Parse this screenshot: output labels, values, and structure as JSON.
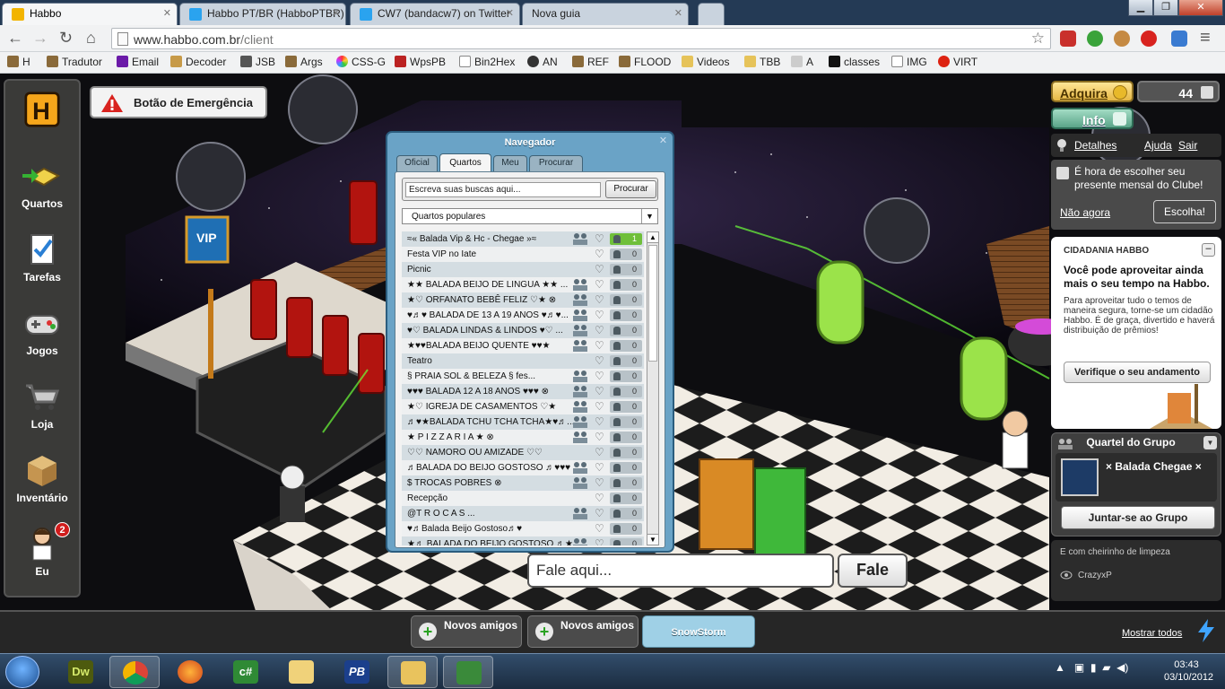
{
  "browser": {
    "tabs": [
      {
        "label": "Habbo",
        "active": true
      },
      {
        "label": "Habbo PT/BR (HabboPTBR)",
        "active": false
      },
      {
        "label": "CW7 (bandacw7) on Twitter",
        "active": false
      },
      {
        "label": "Nova guia",
        "active": false
      }
    ],
    "url_domain": "www.habbo.com.br",
    "url_path": "/client",
    "bookmarks": [
      "H",
      "Tradutor",
      "Email",
      "Decoder",
      "JSB",
      "Args",
      "CSS-G",
      "WpsPB",
      "Bin2Hex",
      "AN",
      "REF",
      "FLOOD",
      "Videos",
      "TBB",
      "A",
      "classes",
      "IMG",
      "VIRT"
    ]
  },
  "toolbar": {
    "items": [
      {
        "label": "Quartos",
        "icon": "rooms-icon"
      },
      {
        "label": "Tarefas",
        "icon": "quests-icon"
      },
      {
        "label": "Jogos",
        "icon": "gamepad-icon"
      },
      {
        "label": "Loja",
        "icon": "shop-cart-icon"
      },
      {
        "label": "Inventário",
        "icon": "inventory-box-icon"
      },
      {
        "label": "Eu",
        "icon": "avatar-icon",
        "badge": "2"
      }
    ]
  },
  "emergency": {
    "label": "Botão de Emergência"
  },
  "navigator": {
    "title": "Navegador",
    "tabs": [
      "Oficial",
      "Quartos",
      "Meu",
      "Procurar"
    ],
    "active_tab": "Quartos",
    "search_placeholder": "Escreva suas buscas aqui...",
    "search_button": "Procurar",
    "category": "Quartos populares",
    "rooms": [
      {
        "name": "≈« Balada Vip & Hc - Chegae »≈",
        "group": true,
        "count": "1",
        "active": true
      },
      {
        "name": "Festa VIP no Iate",
        "group": false,
        "count": "0",
        "active": false
      },
      {
        "name": "Picnic",
        "group": false,
        "count": "0",
        "active": false
      },
      {
        "name": "★★ BALADA BEIJO DE LINGUA ★★ ...",
        "group": true,
        "count": "0",
        "active": false
      },
      {
        "name": "★♡ ORFANATO BEBÊ FELIZ ♡★ ⊗",
        "group": true,
        "count": "0",
        "active": false
      },
      {
        "name": "♥♬♥ BALADA DE 13 A 19 ANOS ♥♬♥...",
        "group": true,
        "count": "0",
        "active": false
      },
      {
        "name": "♥♡ BALADA LINDAS & LINDOS ♥♡ ...",
        "group": true,
        "count": "0",
        "active": false
      },
      {
        "name": "★♥♥BALADA BEIJO QUENTE ♥♥★",
        "group": true,
        "count": "0",
        "active": false
      },
      {
        "name": "Teatro",
        "group": false,
        "count": "0",
        "active": false
      },
      {
        "name": "§ PRAIA SOL & BELEZA § fes...",
        "group": true,
        "count": "0",
        "active": false
      },
      {
        "name": "♥♥♥ BALADA  12 A 18 ANOS ♥♥♥ ⊗",
        "group": true,
        "count": "0",
        "active": false
      },
      {
        "name": "★♡ IGREJA DE CASAMENTOS ♡★",
        "group": true,
        "count": "0",
        "active": false
      },
      {
        "name": "♬♥★BALADA TCHU TCHA TCHA★♥♬...",
        "group": true,
        "count": "0",
        "active": false
      },
      {
        "name": "★   P I Z Z A R I A   ★  ⊗",
        "group": true,
        "count": "0",
        "active": false
      },
      {
        "name": "♡♡ NAMORO OU AMIZADE ♡♡",
        "group": false,
        "count": "0",
        "active": false
      },
      {
        "name": "♬BALADA DO BEIJO GOSTOSO ♬♥♥♥ ...",
        "group": true,
        "count": "0",
        "active": false
      },
      {
        "name": "$ TROCAS POBRES      ⊗",
        "group": true,
        "count": "0",
        "active": false
      },
      {
        "name": "Recepção",
        "group": false,
        "count": "0",
        "active": false
      },
      {
        "name": "@T   R   O   C   A   S ...",
        "group": true,
        "count": "0",
        "active": false
      },
      {
        "name": "♥♬Balada Beijo Gostoso♬♥",
        "group": false,
        "count": "0",
        "active": false
      },
      {
        "name": "★♬ BALADA DO BEIJO GOSTOSO ♬★...",
        "group": true,
        "count": "0",
        "active": false
      }
    ]
  },
  "chat": {
    "placeholder": "Fale aqui...",
    "send_label": "Fale"
  },
  "room_sign": {
    "text": "VIP"
  },
  "right": {
    "buy_label": "Adquira",
    "credits": "44",
    "info_label": "Info",
    "links": {
      "details": "Detalhes",
      "help": "Ajuda",
      "logout": "Sair"
    },
    "club": {
      "message": "É hora de escolher seu presente mensal do Clube!",
      "no": "Não agora",
      "choose": "Escolha!"
    },
    "citizen": {
      "title": "CIDADANIA HABBO",
      "heading": "Você pode aproveitar ainda mais o seu tempo na Habbo.",
      "body": "Para aproveitar tudo o temos de maneira segura, torne-se um cidadão Habbo. É de graça, divertido e haverá distribuição de prêmios!",
      "button": "Verifique o seu andamento"
    },
    "group": {
      "title": "Quartel do Grupo",
      "name": "× Balada Chegae ×",
      "join": "Juntar-se ao Grupo"
    },
    "room_info": {
      "desc": "E com cheirinho de limpeza",
      "owner": "CrazyxP"
    }
  },
  "bottombar": {
    "requests": [
      "Novos amigos",
      "Novos amigos"
    ],
    "snowstorm": "SnowStorm",
    "show_all": "Mostrar todos"
  },
  "taskbar": {
    "apps": [
      "Dw",
      "Chrome",
      "Firefox",
      "c#",
      "Paint",
      "PB",
      "Explorer",
      "Monitor"
    ],
    "time": "03:43",
    "date": "03/10/2012"
  }
}
